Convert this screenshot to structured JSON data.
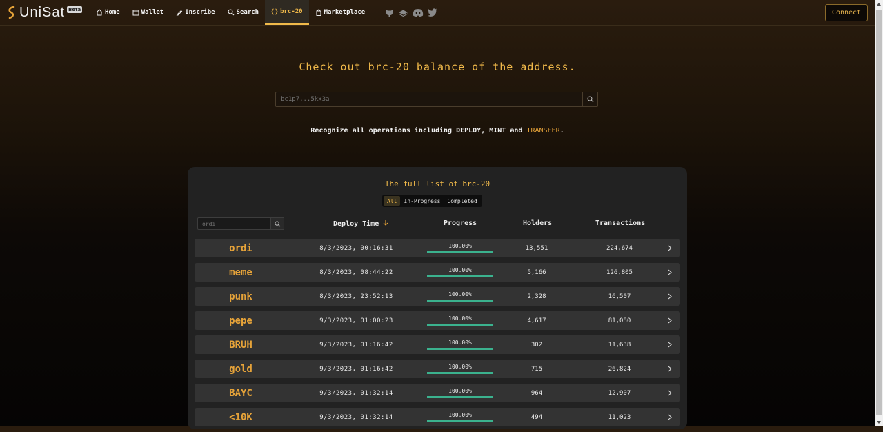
{
  "brand": {
    "name": "UniSat",
    "badge": "Beta"
  },
  "nav": [
    {
      "label": "Home",
      "icon": "home-icon"
    },
    {
      "label": "Wallet",
      "icon": "wallet-icon"
    },
    {
      "label": "Inscribe",
      "icon": "pencil-icon"
    },
    {
      "label": "Search",
      "icon": "search-icon"
    },
    {
      "label": "brc-20",
      "icon": "braces-icon",
      "active": true
    },
    {
      "label": "Marketplace",
      "icon": "bag-icon"
    }
  ],
  "social_icons": [
    "github-icon",
    "gitbook-icon",
    "discord-icon",
    "twitter-icon"
  ],
  "connect_label": "Connect",
  "hero": {
    "title": "Check out brc-20 balance of the address.",
    "search_placeholder": "bc1p7...5kx3a",
    "recognize_prefix": "Recognize all operations including DEPLOY, MINT and ",
    "recognize_highlight": "TRANSFER",
    "recognize_suffix": "."
  },
  "list": {
    "title": "The full list of brc-20",
    "tabs": [
      {
        "label": "All",
        "active": true
      },
      {
        "label": "In-Progress",
        "active": false
      },
      {
        "label": "Completed",
        "active": false
      }
    ],
    "filter_placeholder": "ordi",
    "headers": {
      "deploy_time": "Deploy Time",
      "progress": "Progress",
      "holders": "Holders",
      "transactions": "Transactions"
    },
    "rows": [
      {
        "ticker": "ordi",
        "time": "8/3/2023, 00:16:31",
        "progress": "100.00%",
        "progress_value": 1.0,
        "holders": "13,551",
        "transactions": "224,674"
      },
      {
        "ticker": "meme",
        "time": "8/3/2023, 08:44:22",
        "progress": "100.00%",
        "progress_value": 1.0,
        "holders": "5,166",
        "transactions": "126,805"
      },
      {
        "ticker": "punk",
        "time": "8/3/2023, 23:52:13",
        "progress": "100.00%",
        "progress_value": 1.0,
        "holders": "2,328",
        "transactions": "16,507"
      },
      {
        "ticker": "pepe",
        "time": "9/3/2023, 01:00:23",
        "progress": "100.00%",
        "progress_value": 1.0,
        "holders": "4,617",
        "transactions": "81,080"
      },
      {
        "ticker": "BRUH",
        "time": "9/3/2023, 01:16:42",
        "progress": "100.00%",
        "progress_value": 1.0,
        "holders": "302",
        "transactions": "11,638"
      },
      {
        "ticker": "gold",
        "time": "9/3/2023, 01:16:42",
        "progress": "100.00%",
        "progress_value": 1.0,
        "holders": "715",
        "transactions": "26,824"
      },
      {
        "ticker": "BAYC",
        "time": "9/3/2023, 01:32:14",
        "progress": "100.00%",
        "progress_value": 1.0,
        "holders": "964",
        "transactions": "12,907"
      },
      {
        "ticker": "<10K",
        "time": "9/3/2023, 01:32:14",
        "progress": "100.00%",
        "progress_value": 1.0,
        "holders": "494",
        "transactions": "11,023"
      }
    ]
  },
  "colors": {
    "accent": "#f0b94a",
    "progress": "#3bb28e",
    "panel": "#222222",
    "row": "#333333"
  }
}
